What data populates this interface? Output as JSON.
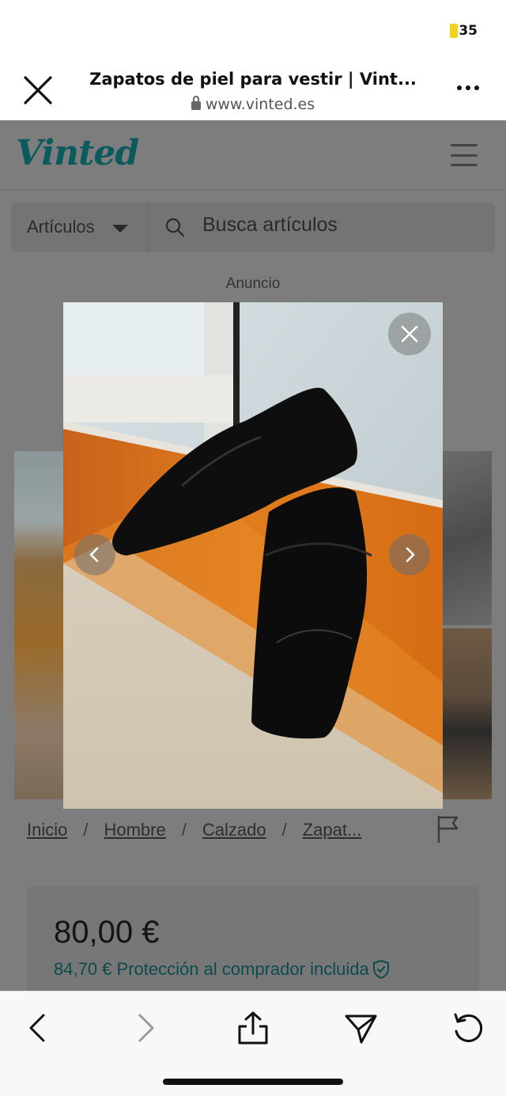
{
  "status": {
    "battery": "35"
  },
  "browser": {
    "title": "Zapatos de piel para vestir | Vint...",
    "url": "www.vinted.es"
  },
  "site": {
    "logo": "Vinted",
    "search": {
      "category_label": "Artículos",
      "placeholder": "Busca artículos"
    },
    "ad_label": "Anuncio"
  },
  "breadcrumb": [
    "Inicio",
    "Hombre",
    "Calzado",
    "Zapat..."
  ],
  "listing": {
    "price": "80,00 €",
    "buyer_price": "84,70 € Protección al comprador incluida"
  },
  "colors": {
    "brand": "#0b5a5e",
    "overlay": "#7d7d7d",
    "toolbar_bg": "#f8f8f8"
  },
  "icons": {
    "toolbar": [
      "back-arrow-icon",
      "forward-arrow-icon",
      "share-icon",
      "send-icon",
      "reload-icon"
    ],
    "lightbox": [
      "close-icon",
      "chevron-left-icon",
      "chevron-right-icon"
    ]
  }
}
